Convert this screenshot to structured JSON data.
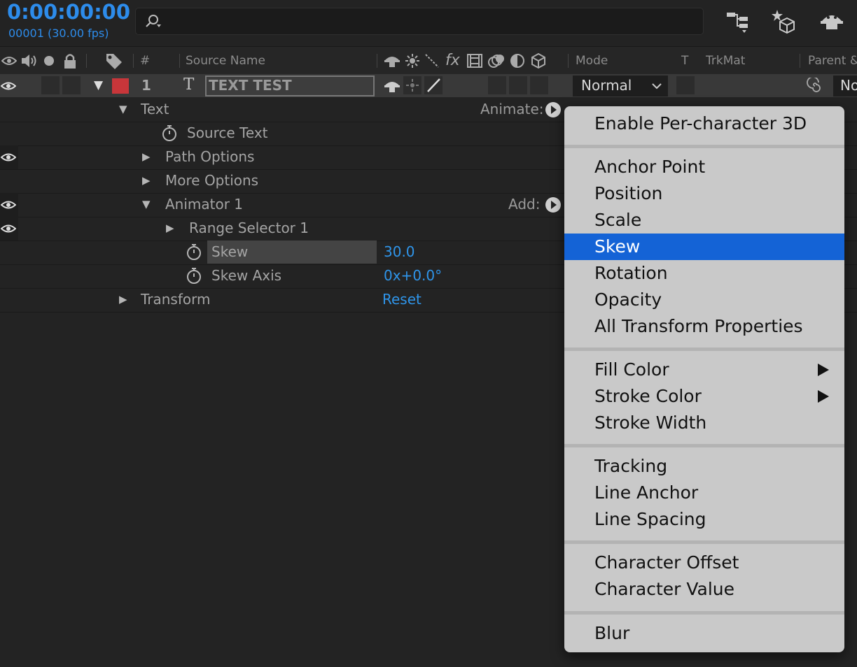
{
  "header": {
    "timecode": "0:00:00:00",
    "frame_fps": "00001 (30.00 fps)",
    "search_placeholder": ""
  },
  "columns": {
    "number": "#",
    "source_name": "Source Name",
    "mode": "Mode",
    "t": "T",
    "trkmat": "TrkMat",
    "parent": "Parent &"
  },
  "layer": {
    "number": "1",
    "type_glyph": "T",
    "name": "TEXT TEST",
    "mode": "Normal",
    "parent_value": "No",
    "label_color": "#c8363a"
  },
  "properties": {
    "text": "Text",
    "animate_label": "Animate:",
    "source_text": "Source Text",
    "path_options": "Path Options",
    "more_options": "More Options",
    "animator_1": "Animator 1",
    "add_label": "Add:",
    "range_selector_1": "Range Selector 1",
    "skew": "Skew",
    "skew_value": "30.0",
    "skew_axis": "Skew Axis",
    "skew_axis_value": "0x+0.0°",
    "transform": "Transform",
    "transform_value": "Reset"
  },
  "menu": {
    "items": [
      {
        "label": "Enable Per-character 3D"
      },
      {
        "label": "Anchor Point"
      },
      {
        "label": "Position"
      },
      {
        "label": "Scale"
      },
      {
        "label": "Skew",
        "selected": true
      },
      {
        "label": "Rotation"
      },
      {
        "label": "Opacity"
      },
      {
        "label": "All Transform Properties"
      },
      {
        "label": "Fill Color",
        "submenu": true
      },
      {
        "label": "Stroke Color",
        "submenu": true
      },
      {
        "label": "Stroke Width"
      },
      {
        "label": "Tracking"
      },
      {
        "label": "Line Anchor"
      },
      {
        "label": "Line Spacing"
      },
      {
        "label": "Character Offset"
      },
      {
        "label": "Character Value"
      },
      {
        "label": "Blur"
      }
    ]
  },
  "colors": {
    "accent_blue": "#2d8ceb",
    "selection_blue": "#1463d6"
  }
}
